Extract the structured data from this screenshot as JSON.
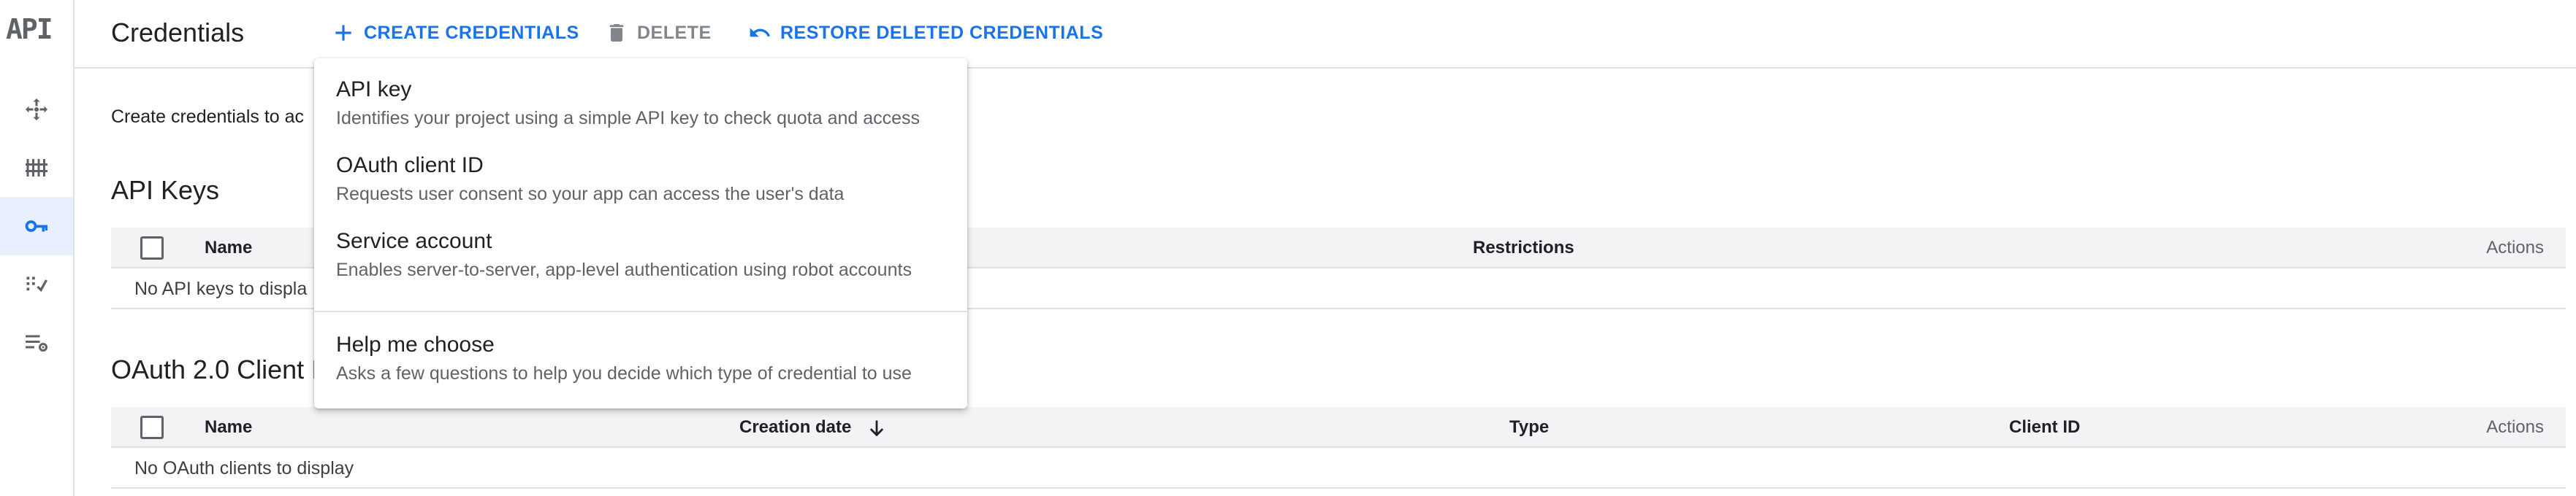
{
  "rail": {
    "logo": "API",
    "items": [
      {
        "name": "rail-item-overview",
        "icon": "diamond-arrows-icon",
        "active": false
      },
      {
        "name": "rail-item-library",
        "icon": "library-icon",
        "active": false
      },
      {
        "name": "rail-item-credentials",
        "icon": "key-icon",
        "active": true
      },
      {
        "name": "rail-item-oauth-consent",
        "icon": "consent-screen-icon",
        "active": false
      },
      {
        "name": "rail-item-page-usage",
        "icon": "settings-list-icon",
        "active": false
      }
    ]
  },
  "header": {
    "title": "Credentials",
    "create_label": "CREATE CREDENTIALS",
    "delete_label": "DELETE",
    "restore_label": "RESTORE DELETED CREDENTIALS"
  },
  "main": {
    "intro": "Create credentials to ac",
    "api_keys": {
      "title": "API Keys",
      "columns": {
        "name": "Name",
        "restrictions": "Restrictions",
        "actions": "Actions"
      },
      "empty": "No API keys to displa"
    },
    "oauth": {
      "title": "OAuth 2.0 Client I",
      "columns": {
        "name": "Name",
        "creation_date": "Creation date",
        "type": "Type",
        "client_id": "Client ID",
        "actions": "Actions"
      },
      "empty": "No OAuth clients to display"
    }
  },
  "menu": {
    "items": [
      {
        "title": "API key",
        "desc": "Identifies your project using a simple API key to check quota and access"
      },
      {
        "title": "OAuth client ID",
        "desc": "Requests user consent so your app can access the user's data"
      },
      {
        "title": "Service account",
        "desc": "Enables server-to-server, app-level authentication using robot accounts"
      }
    ],
    "help": {
      "title": "Help me choose",
      "desc": "Asks a few questions to help you decide which type of credential to use"
    }
  },
  "colors": {
    "accent": "#1a73e8",
    "active_bg": "#e8f0fe",
    "muted": "#5f6368"
  }
}
